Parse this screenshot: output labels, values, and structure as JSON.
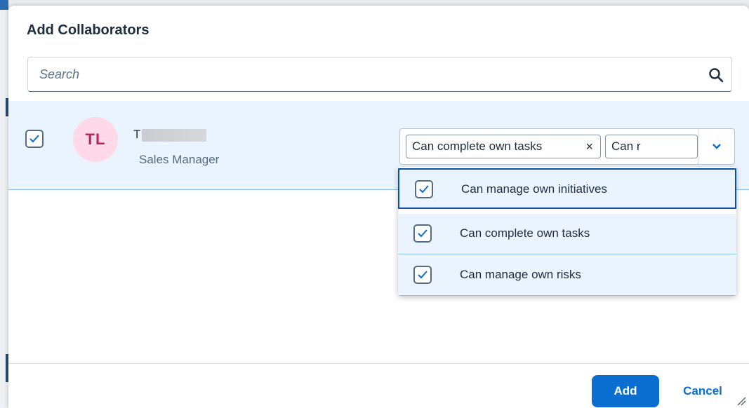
{
  "dialog": {
    "title": "Add Collaborators",
    "search": {
      "placeholder": "Search",
      "value": ""
    }
  },
  "collaborator": {
    "checked": true,
    "initials": "TL",
    "name_visible": "T",
    "role": "Sales Manager",
    "tokens": [
      {
        "label": "Can complete own tasks"
      },
      {
        "label": "Can r"
      }
    ]
  },
  "permissions_dropdown": {
    "options": [
      {
        "label": "Can manage own initiatives",
        "checked": true
      },
      {
        "label": "Can complete own tasks",
        "checked": true
      },
      {
        "label": "Can manage own risks",
        "checked": true
      }
    ]
  },
  "footer": {
    "add_label": "Add",
    "cancel_label": "Cancel"
  },
  "colors": {
    "accent": "#0a6ed1",
    "row_selected": "#eaf4ff",
    "avatar_bg": "#ffd9e8",
    "avatar_text": "#c0245f"
  }
}
